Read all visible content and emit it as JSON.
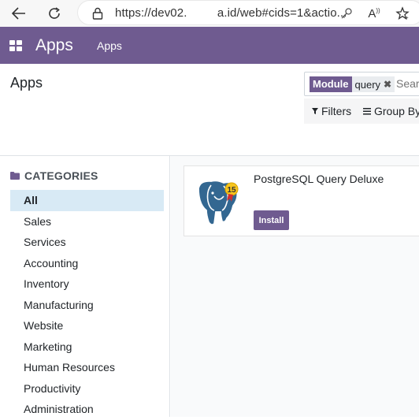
{
  "browser": {
    "url_prefix": "https://dev02.",
    "url_suffix": "a.id/web#cids=1&actio...",
    "icons": [
      "back-icon",
      "reload-icon",
      "lock-icon",
      "key-icon",
      "read-aloud-icon",
      "favorite-icon"
    ]
  },
  "navbar": {
    "brand": "Apps",
    "menu_item": "Apps",
    "color": "#6f5b90"
  },
  "control_panel": {
    "breadcrumb": "Apps",
    "search": {
      "facet_label": "Module",
      "facet_value": "query",
      "placeholder": "Search..."
    },
    "filters_label": "Filters",
    "group_by_label": "Group By"
  },
  "sidebar": {
    "header": "CATEGORIES",
    "items": [
      {
        "label": "All",
        "active": true
      },
      {
        "label": "Sales"
      },
      {
        "label": "Services"
      },
      {
        "label": "Accounting"
      },
      {
        "label": "Inventory"
      },
      {
        "label": "Manufacturing"
      },
      {
        "label": "Website"
      },
      {
        "label": "Marketing"
      },
      {
        "label": "Human Resources"
      },
      {
        "label": "Productivity"
      },
      {
        "label": "Administration"
      }
    ]
  },
  "apps": [
    {
      "name": "PostgreSQL Query Deluxe",
      "version_badge": "15",
      "install_label": "Install",
      "icon": "postgresql-elephant-icon"
    }
  ]
}
